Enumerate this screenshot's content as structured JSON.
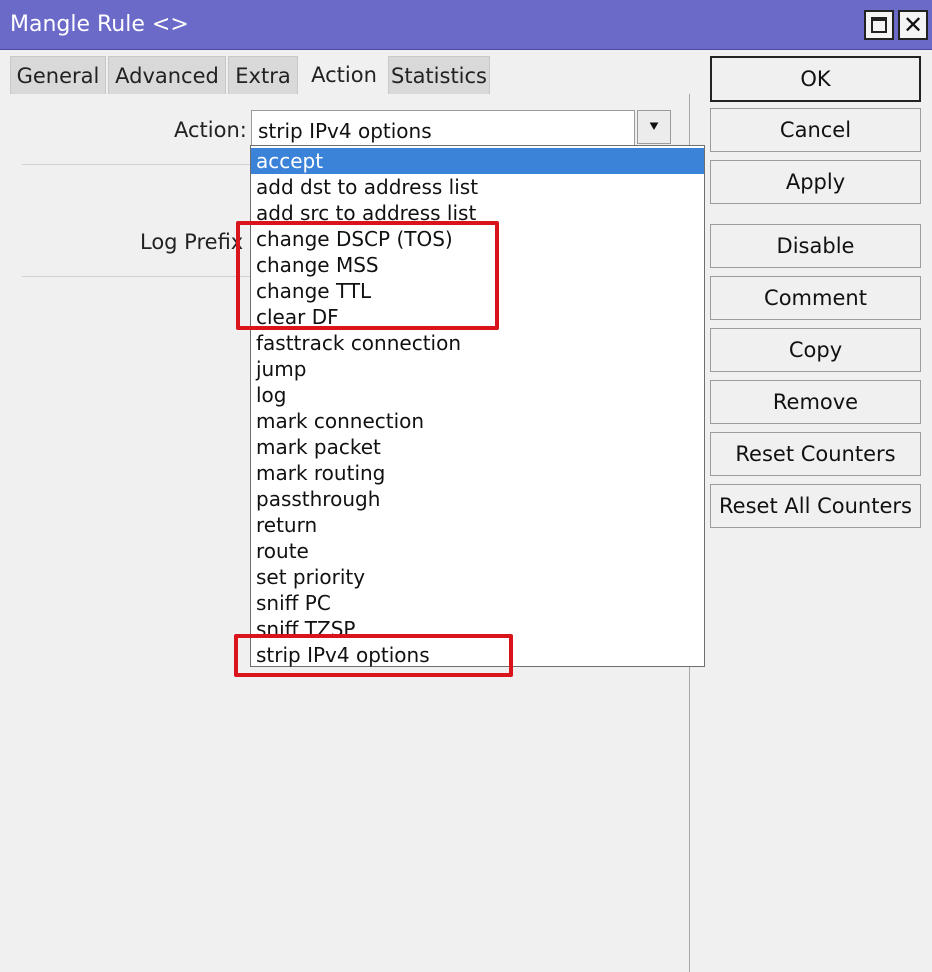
{
  "window": {
    "title": "Mangle Rule <>",
    "maximize_icon": "maximize-icon",
    "close_icon": "close-icon",
    "title_bar_color": "#6b6ac9"
  },
  "tabs": [
    {
      "label": "General"
    },
    {
      "label": "Advanced"
    },
    {
      "label": "Extra"
    },
    {
      "label": "Action",
      "active": true
    },
    {
      "label": "Statistics"
    }
  ],
  "form": {
    "action_label": "Action:",
    "action_value": "strip IPv4 options",
    "log_prefix_label": "Log Prefix"
  },
  "dropdown": {
    "selected_option": "accept",
    "selection_color": "#3b82d9",
    "options": [
      "accept",
      "add dst to address list",
      "add src to address list",
      "change DSCP (TOS)",
      "change MSS",
      "change TTL",
      "clear DF",
      "fasttrack connection",
      "jump",
      "log",
      "mark connection",
      "mark packet",
      "mark routing",
      "passthrough",
      "return",
      "route",
      "set priority",
      "sniff PC",
      "sniff TZSP",
      "strip IPv4 options"
    ],
    "highlight_color": "#d9141b"
  },
  "buttons": {
    "ok": "OK",
    "cancel": "Cancel",
    "apply": "Apply",
    "disable": "Disable",
    "comment": "Comment",
    "copy": "Copy",
    "remove": "Remove",
    "reset_counters": "Reset Counters",
    "reset_all_counters": "Reset All Counters"
  }
}
